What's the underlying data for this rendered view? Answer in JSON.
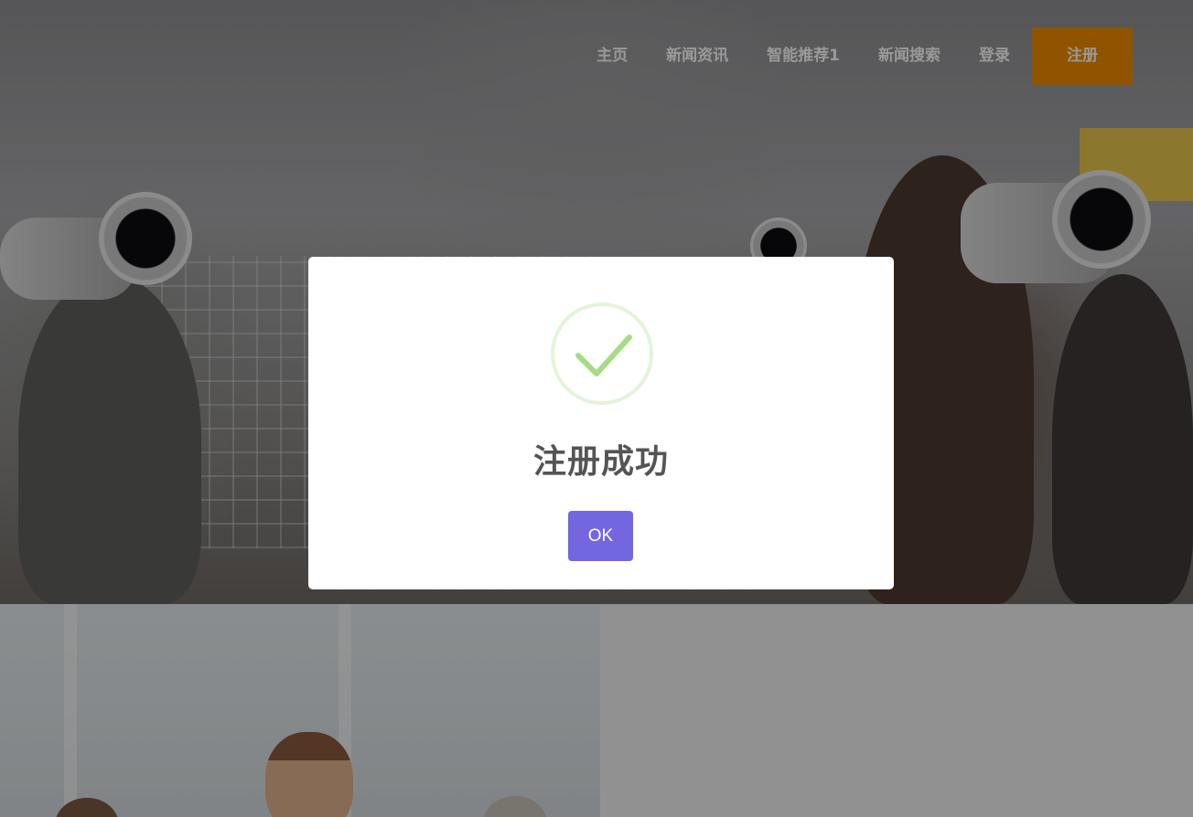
{
  "nav": {
    "items": [
      {
        "label": "主页"
      },
      {
        "label": "新闻资讯"
      },
      {
        "label": "智能推荐1"
      },
      {
        "label": "新闻搜索"
      },
      {
        "label": "登录"
      }
    ],
    "register_label": "注册"
  },
  "modal": {
    "icon": "success-check-icon",
    "title": "注册成功",
    "ok_label": "OK"
  },
  "colors": {
    "accent": "#f08c00",
    "ok_button": "#7367e0",
    "success_green": "#a5dc86",
    "title_text": "#545454"
  }
}
